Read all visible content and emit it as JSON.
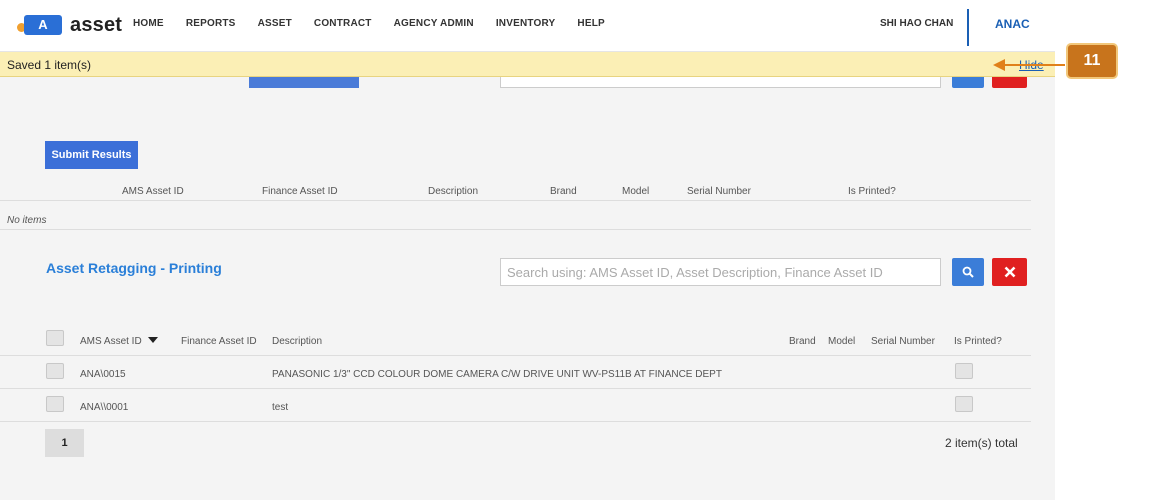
{
  "app": {
    "logo_badge": "A",
    "logo_text": "asset"
  },
  "nav": {
    "items": [
      "HOME",
      "REPORTS",
      "ASSET",
      "CONTRACT",
      "AGENCY ADMIN",
      "INVENTORY",
      "HELP"
    ],
    "user_name": "SHI HAO CHAN",
    "agency": "ANAC"
  },
  "banner": {
    "message": "Saved 1 item(s)",
    "hide_label": "Hide"
  },
  "callout": {
    "label": "11",
    "color": "#c8741c"
  },
  "upper_section": {
    "submit_label": "Submit Results",
    "columns": [
      "AMS Asset ID",
      "Finance Asset ID",
      "Description",
      "Brand",
      "Model",
      "Serial Number",
      "Is Printed?"
    ],
    "empty_text": "No items"
  },
  "printing_section": {
    "title": "Asset Retagging - Printing",
    "search_placeholder": "Search using: AMS Asset ID, Asset Description, Finance Asset ID",
    "columns": {
      "ams_id": "AMS Asset ID",
      "finance_id": "Finance Asset ID",
      "description": "Description",
      "brand": "Brand",
      "model": "Model",
      "serial": "Serial Number",
      "printed": "Is Printed?"
    },
    "rows": [
      {
        "ams_id": "ANA\\0015",
        "description": "PANASONIC 1/3\" CCD COLOUR DOME CAMERA C/W DRIVE UNIT WV-PS11B AT FINANCE DEPT"
      },
      {
        "ams_id": "ANA\\\\0001",
        "description": "test"
      }
    ],
    "page": "1",
    "total": "2 item(s) total"
  },
  "colors": {
    "accent": "#2a7fd8",
    "primary_button": "#3b6fd8",
    "danger": "#e02020",
    "banner": "#fbefb5"
  }
}
